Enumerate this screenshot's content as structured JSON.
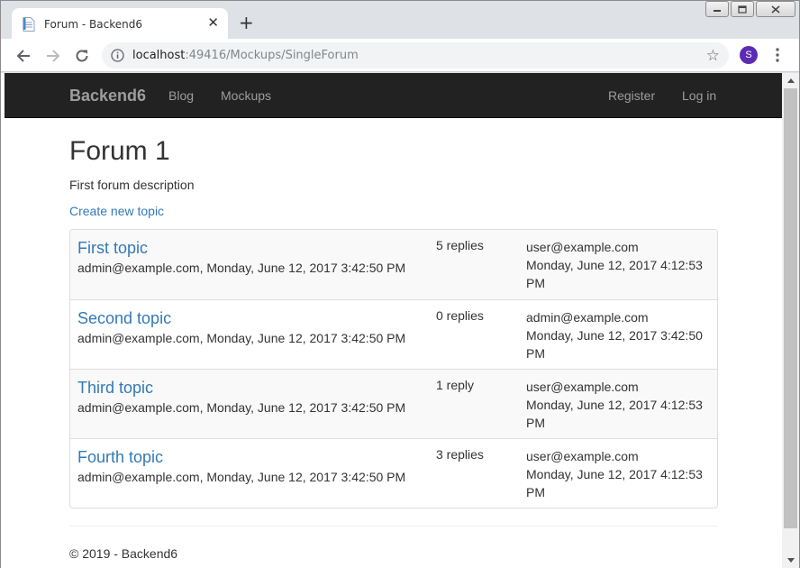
{
  "browser": {
    "tab_title": "Forum - Backend6",
    "tab_close": "✕",
    "new_tab": "+",
    "url_host": "localhost",
    "url_rest": ":49416/Mockups/SingleForum",
    "profile_initial": "S"
  },
  "site": {
    "brand": "Backend6",
    "nav_left": [
      "Blog",
      "Mockups"
    ],
    "nav_right": [
      "Register",
      "Log in"
    ]
  },
  "forum": {
    "title": "Forum 1",
    "description": "First forum description",
    "create_link": "Create new topic"
  },
  "topics": [
    {
      "title": "First topic",
      "meta": "admin@example.com, Monday, June 12, 2017 3:42:50 PM",
      "replies": "5 replies",
      "last_user": "user@example.com",
      "last_date": "Monday, June 12, 2017 4:12:53 PM"
    },
    {
      "title": "Second topic",
      "meta": "admin@example.com, Monday, June 12, 2017 3:42:50 PM",
      "replies": "0 replies",
      "last_user": "admin@example.com",
      "last_date": "Monday, June 12, 2017 3:42:50 PM"
    },
    {
      "title": "Third topic",
      "meta": "admin@example.com, Monday, June 12, 2017 3:42:50 PM",
      "replies": "1 reply",
      "last_user": "user@example.com",
      "last_date": "Monday, June 12, 2017 4:12:53 PM"
    },
    {
      "title": "Fourth topic",
      "meta": "admin@example.com, Monday, June 12, 2017 3:42:50 PM",
      "replies": "3 replies",
      "last_user": "user@example.com",
      "last_date": "Monday, June 12, 2017 4:12:53 PM"
    }
  ],
  "footer": {
    "text": "© 2019 - Backend6"
  },
  "colors": {
    "navbar_bg": "#222222",
    "link": "#337ab7",
    "profile": "#5c2bb6"
  }
}
